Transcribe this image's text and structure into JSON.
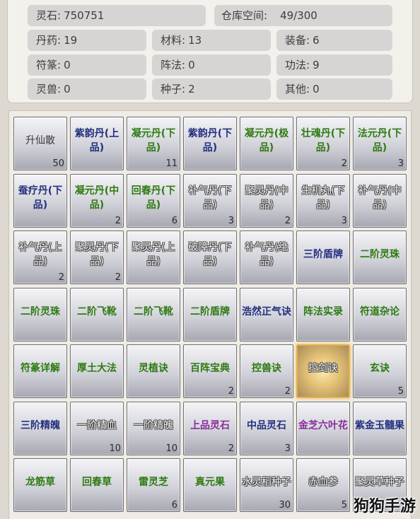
{
  "stats": {
    "spirit_stone": {
      "label": "灵石",
      "value": "750751"
    },
    "warehouse": {
      "label": "仓库空间",
      "value": "49/300"
    },
    "pills": {
      "label": "丹药",
      "value": "19"
    },
    "materials": {
      "label": "材料",
      "value": "13"
    },
    "equipment": {
      "label": "装备",
      "value": "6"
    },
    "talismans": {
      "label": "符篆",
      "value": "0"
    },
    "formations": {
      "label": "阵法",
      "value": "0"
    },
    "techniques": {
      "label": "功法",
      "value": "9"
    },
    "beasts": {
      "label": "灵兽",
      "value": "0"
    },
    "seeds": {
      "label": "种子",
      "value": "2"
    },
    "other": {
      "label": "其他",
      "value": "0"
    }
  },
  "colors": {
    "white": "#f4f4f4",
    "green": "#2f7a12",
    "purple": "#8a2c9a",
    "navy": "#25307f",
    "gray": "#3a3a3a"
  },
  "items": [
    {
      "name": "升仙散",
      "count": "50",
      "color": "gray"
    },
    {
      "name": "紫韵丹(上品)",
      "count": "",
      "color": "navy"
    },
    {
      "name": "凝元丹(下品)",
      "count": "11",
      "color": "green"
    },
    {
      "name": "紫韵丹(下品)",
      "count": "",
      "color": "navy"
    },
    {
      "name": "凝元丹(极品)",
      "count": "",
      "color": "green"
    },
    {
      "name": "壮魂丹(下品)",
      "count": "2",
      "color": "green"
    },
    {
      "name": "法元丹(下品)",
      "count": "3",
      "color": "green"
    },
    {
      "name": "蚕疗丹(下品)",
      "count": "",
      "color": "navy"
    },
    {
      "name": "凝元丹(中品)",
      "count": "2",
      "color": "green"
    },
    {
      "name": "回春丹(下品)",
      "count": "6",
      "color": "green"
    },
    {
      "name": "补气丹(下品)",
      "count": "3",
      "color": "white"
    },
    {
      "name": "聚灵丹(中品)",
      "count": "2",
      "color": "white"
    },
    {
      "name": "生机丸(下品)",
      "count": "3",
      "color": "white"
    },
    {
      "name": "补气丹(中品)",
      "count": "",
      "color": "white"
    },
    {
      "name": "补气丹(上品)",
      "count": "2",
      "color": "white"
    },
    {
      "name": "聚灵丹(下品)",
      "count": "2",
      "color": "white"
    },
    {
      "name": "聚灵丹(上品)",
      "count": "",
      "color": "white"
    },
    {
      "name": "破障丹(下品)",
      "count": "",
      "color": "white"
    },
    {
      "name": "补气丹(绝品)",
      "count": "",
      "color": "white"
    },
    {
      "name": "三阶盾牌",
      "count": "",
      "color": "navy"
    },
    {
      "name": "二阶灵珠",
      "count": "",
      "color": "green"
    },
    {
      "name": "二阶灵珠",
      "count": "",
      "color": "green"
    },
    {
      "name": "二阶飞靴",
      "count": "",
      "color": "green"
    },
    {
      "name": "二阶飞靴",
      "count": "",
      "color": "green"
    },
    {
      "name": "二阶盾牌",
      "count": "",
      "color": "green"
    },
    {
      "name": "浩然正气诀",
      "count": "",
      "color": "navy"
    },
    {
      "name": "阵法实录",
      "count": "",
      "color": "green"
    },
    {
      "name": "符道杂论",
      "count": "",
      "color": "green"
    },
    {
      "name": "符篆详解",
      "count": "",
      "color": "green"
    },
    {
      "name": "厚土大法",
      "count": "",
      "color": "green"
    },
    {
      "name": "灵植诀",
      "count": "",
      "color": "green"
    },
    {
      "name": "百阵宝典",
      "count": "2",
      "color": "green"
    },
    {
      "name": "控兽诀",
      "count": "2",
      "color": "green"
    },
    {
      "name": "控剑诀",
      "count": "",
      "color": "white",
      "selected": true
    },
    {
      "name": "玄诀",
      "count": "5",
      "color": "green"
    },
    {
      "name": "三阶精魄",
      "count": "",
      "color": "navy"
    },
    {
      "name": "一阶精血",
      "count": "10",
      "color": "white"
    },
    {
      "name": "一阶精魄",
      "count": "10",
      "color": "white"
    },
    {
      "name": "上品灵石",
      "count": "2",
      "color": "purple"
    },
    {
      "name": "中品灵石",
      "count": "3",
      "color": "navy"
    },
    {
      "name": "金芝六叶花",
      "count": "",
      "color": "purple"
    },
    {
      "name": "紫金玉髓果",
      "count": "",
      "color": "navy"
    },
    {
      "name": "龙筋草",
      "count": "",
      "color": "green"
    },
    {
      "name": "回春草",
      "count": "",
      "color": "green"
    },
    {
      "name": "雷灵芝",
      "count": "6",
      "color": "green"
    },
    {
      "name": "真元果",
      "count": "",
      "color": "green"
    },
    {
      "name": "水灵稻种子",
      "count": "30",
      "color": "white"
    },
    {
      "name": "赤血参",
      "count": "5",
      "color": "white"
    },
    {
      "name": "聚灵草种子",
      "count": "",
      "color": "white"
    }
  ],
  "watermark": "狗狗手游"
}
